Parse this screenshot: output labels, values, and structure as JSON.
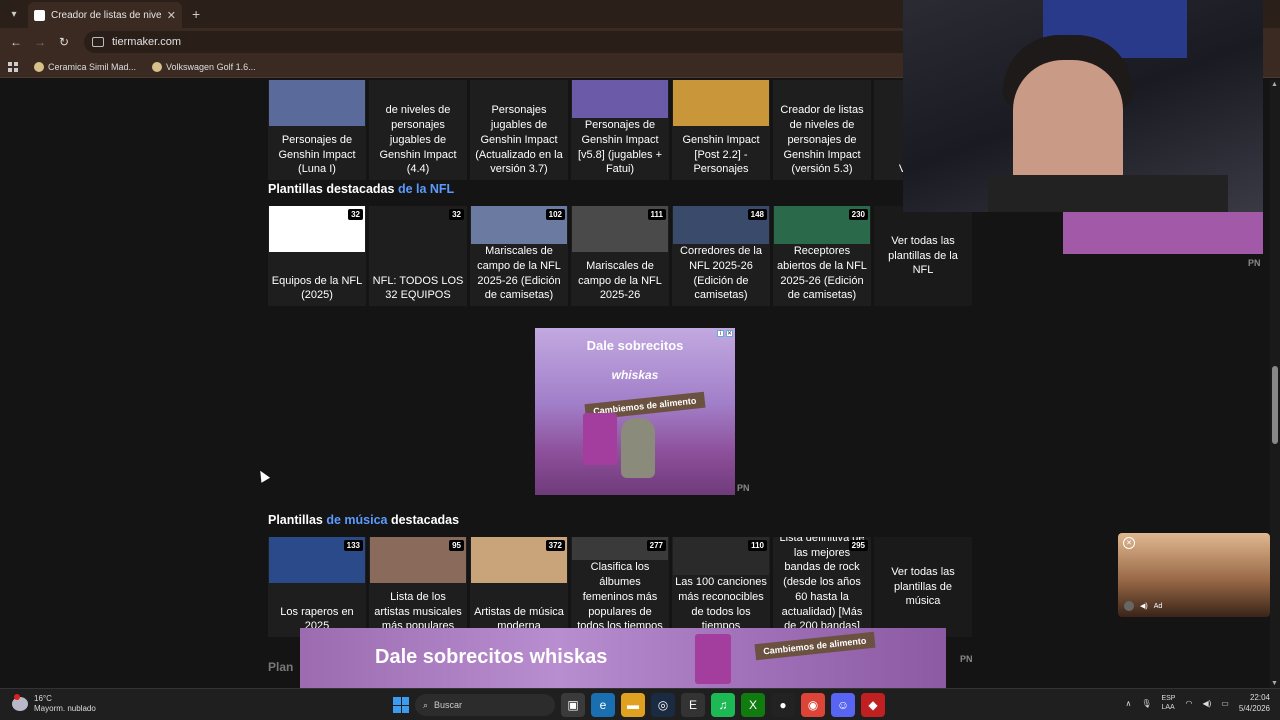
{
  "browser": {
    "tab_title": "Creador de listas de niveles pa",
    "tab_close": "✕",
    "new_tab": "+",
    "url": "tiermaker.com",
    "bookmarks": [
      "Ceramica Simil Mad...",
      "Volkswagen Golf 1.6..."
    ]
  },
  "genshin_row": [
    {
      "label": "Personajes de Genshin Impact (Luna I)",
      "color": "#5a6a9a"
    },
    {
      "label": "de niveles de personajes jugables de Genshin Impact (4.4)",
      "color": ""
    },
    {
      "label": "Personajes jugables de Genshin Impact (Actualizado en la versión 3.7)",
      "color": ""
    },
    {
      "label": "Personajes de Genshin Impact [v5.8] (jugables + Fatui)",
      "color": "#6a5aa8"
    },
    {
      "label": "Genshin Impact [Post 2.2] - Personajes",
      "color": "#c9963a"
    },
    {
      "label": "Creador de listas de niveles de personajes de Genshin Impact (versión 5.3)",
      "color": ""
    },
    {
      "label": "Ve pl Gen",
      "color": ""
    }
  ],
  "nfl": {
    "title_pre": "Plantillas destacadas ",
    "title_hl": "de la NFL",
    "cards": [
      {
        "label": "Equipos de la NFL (2025)",
        "count": "32",
        "color": "#ffffff"
      },
      {
        "label": "NFL: TODOS LOS 32 EQUIPOS",
        "count": "32",
        "color": ""
      },
      {
        "label": "Mariscales de campo de la NFL 2025-26 (Edición de camisetas)",
        "count": "102",
        "color": "#6a7aa0"
      },
      {
        "label": "Mariscales de campo de la NFL 2025-26",
        "count": "111",
        "color": "#4a4a4a"
      },
      {
        "label": "Corredores de la NFL 2025-26 (Edición de camisetas)",
        "count": "148",
        "color": "#3a4a6a"
      },
      {
        "label": "Receptores abiertos de la NFL 2025-26 (Edición de camisetas)",
        "count": "230",
        "color": "#2a6a4a"
      }
    ],
    "see_all": "Ver todas las plantillas de la NFL"
  },
  "ad": {
    "title": "Dale sobrecitos",
    "brand": "whiskas",
    "badge": "Cambiemos de alimento",
    "pn": "PN"
  },
  "music": {
    "title_pre": "Plantillas ",
    "title_hl": "de música",
    "title_post": " destacadas",
    "cards": [
      {
        "label": "Los raperos en 2025",
        "count": "133",
        "color": "#2a4a8a"
      },
      {
        "label": "Lista de los artistas musicales más populares",
        "count": "95",
        "color": "#8a6a5a"
      },
      {
        "label": "Artistas de música moderna",
        "count": "372",
        "color": "#c9a47a"
      },
      {
        "label": "Clasifica los álbumes femeninos más populares de todos los tiempos",
        "count": "277",
        "color": "#3a3a3a"
      },
      {
        "label": "Las 100 canciones más reconocibles de todos los tiempos",
        "count": "110",
        "color": "#2a2a2a"
      },
      {
        "label": "Lista definitiva de las mejores bandas de rock (desde los años 60 hasta la actualidad) [Más de 200 bandas]",
        "count": "295",
        "color": ""
      }
    ],
    "see_all": "Ver todas las plantillas de música"
  },
  "bottom_ad": {
    "title": "Dale sobrecitos whiskas",
    "badge": "Cambiemos de alimento",
    "pn": "PN"
  },
  "next_section_cut": "Plan",
  "video_ad": {
    "label": "Ad"
  },
  "taskbar": {
    "temp": "16°C",
    "weather": "Mayorm. nublado",
    "search": "Buscar",
    "lang1": "ESP",
    "lang2": "LAA",
    "time": "22:04",
    "date": "5/4/2026"
  }
}
